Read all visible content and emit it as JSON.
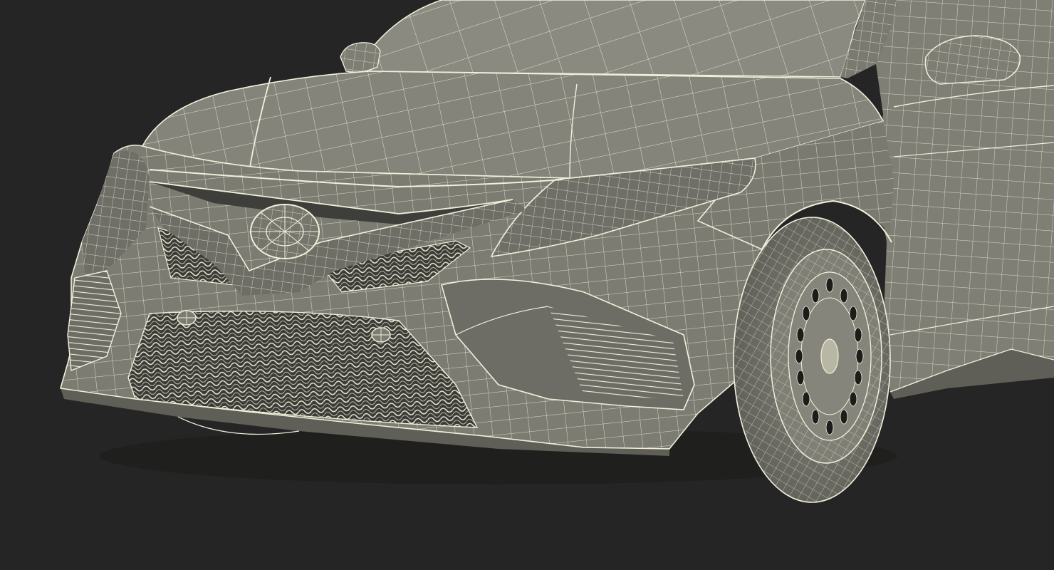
{
  "scene": {
    "subject": "car-wireframe-render",
    "colors": {
      "background": "#252525",
      "surface": "#7c7c72",
      "surface_light": "#8d8d83",
      "surface_dark": "#5f5f57",
      "wire": "#f2f0dc",
      "wire_dim": "#cfcdb9",
      "tire": "#6e6e66",
      "shadow": "#1c1c1a"
    }
  }
}
